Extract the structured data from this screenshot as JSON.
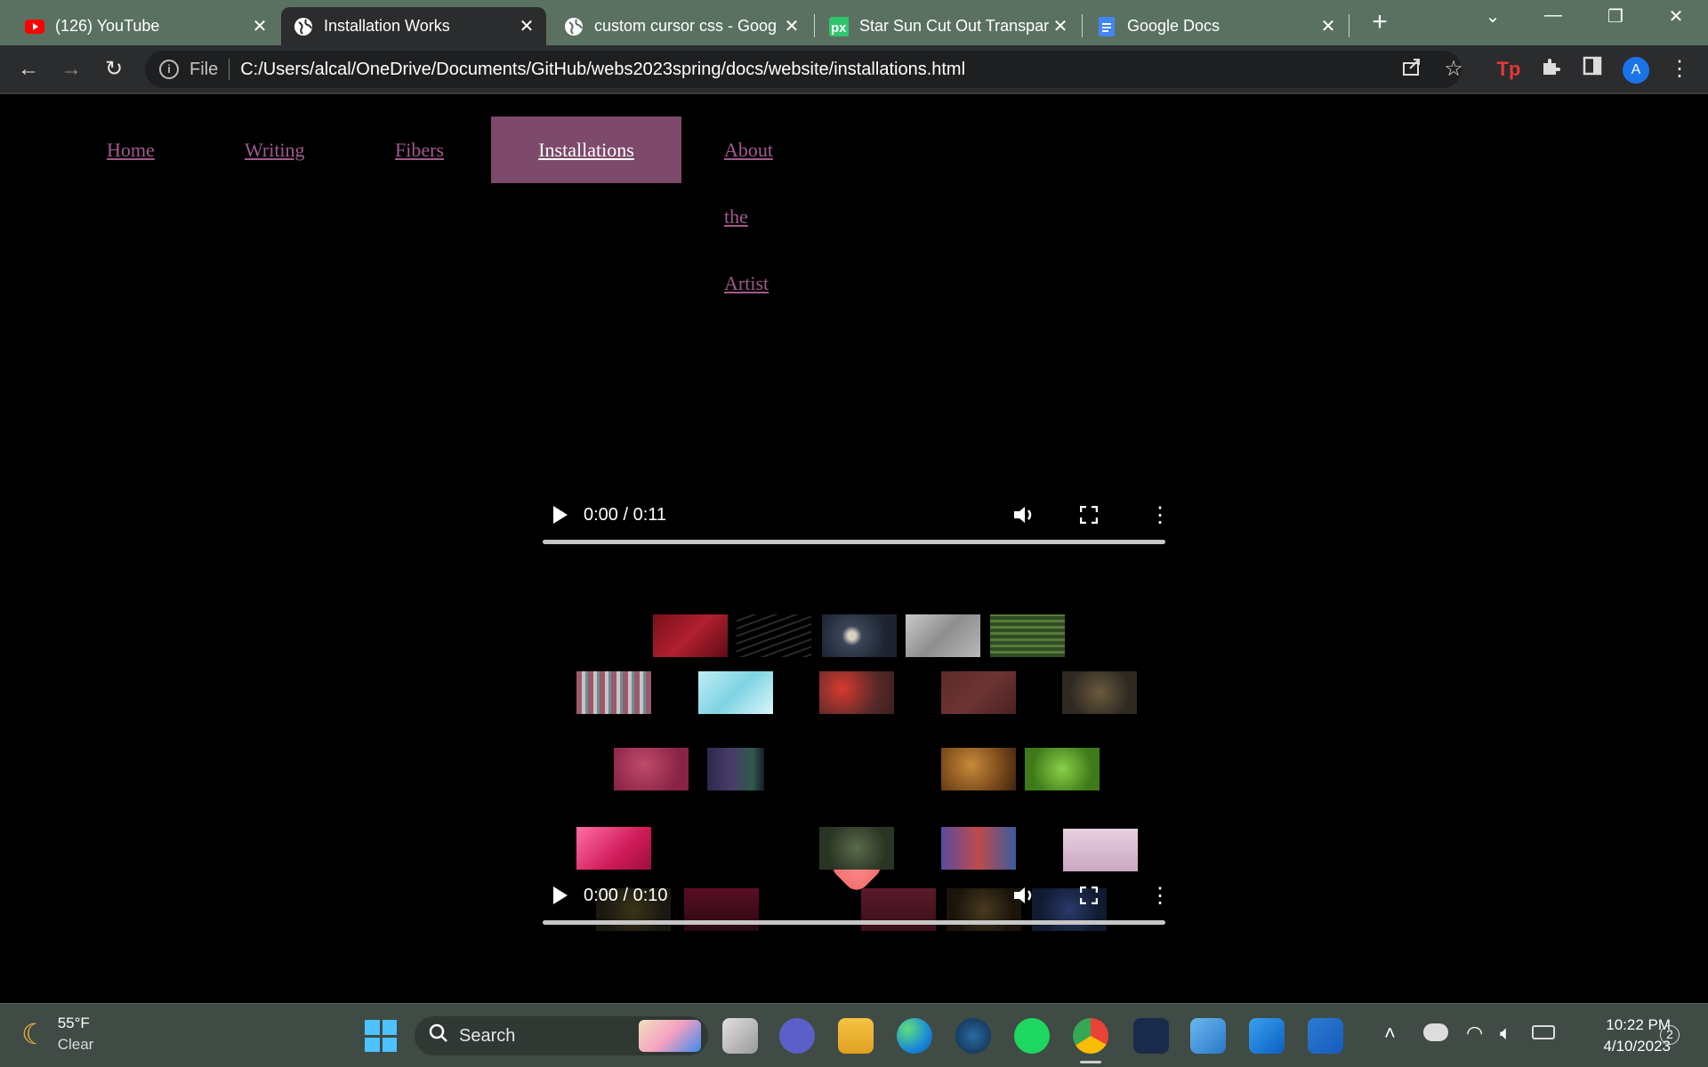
{
  "browser": {
    "tabs": [
      {
        "title": "(126) YouTube",
        "icon": "youtube-icon"
      },
      {
        "title": "Installation Works",
        "icon": "globe-icon",
        "active": true
      },
      {
        "title": "custom cursor css - Goog",
        "icon": "globe-icon"
      },
      {
        "title": "Star Sun Cut Out Transpar",
        "icon": "pixabay-icon"
      },
      {
        "title": "Google Docs",
        "icon": "docs-icon"
      }
    ],
    "url_scheme": "File",
    "url": "C:/Users/alcal/OneDrive/Documents/GitHub/webs2023spring/docs/website/installations.html",
    "profile_initial": "A"
  },
  "nav": {
    "items": [
      "Home",
      "Writing",
      "Fibers",
      "Installations",
      "About the Artist"
    ],
    "active": "Installations"
  },
  "videos": [
    {
      "time": "0:00 / 0:11"
    },
    {
      "time": "0:00 / 0:10"
    }
  ],
  "taskbar": {
    "weather_temp": "55°F",
    "weather_desc": "Clear",
    "search_placeholder": "Search",
    "time": "10:22 PM",
    "date": "4/10/2023",
    "notification_count": "2"
  },
  "colors": {
    "nav_link": "#a05a8a",
    "nav_active_bg": "#7d4a6c",
    "tabstrip_bg": "#5a7162"
  }
}
